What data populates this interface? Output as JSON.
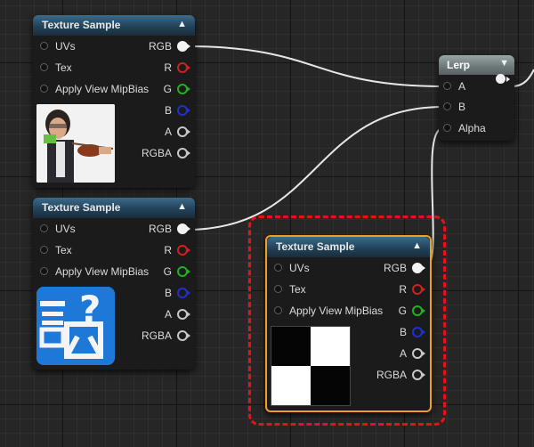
{
  "nodes": [
    {
      "id": "ts1",
      "title": "Texture Sample",
      "inputs": [
        "UVs",
        "Tex",
        "Apply View MipBias"
      ],
      "outputs": [
        "RGB",
        "R",
        "G",
        "B",
        "A",
        "RGBA"
      ],
      "preview": "photo-violinist"
    },
    {
      "id": "ts2",
      "title": "Texture Sample",
      "inputs": [
        "UVs",
        "Tex",
        "Apply View MipBias"
      ],
      "outputs": [
        "RGB",
        "R",
        "G",
        "B",
        "A",
        "RGBA"
      ],
      "preview": "question-mark-kanji-icon",
      "preview_glyph": "?"
    },
    {
      "id": "ts3",
      "title": "Texture Sample",
      "inputs": [
        "UVs",
        "Tex",
        "Apply View MipBias"
      ],
      "outputs": [
        "RGB",
        "R",
        "G",
        "B",
        "A",
        "RGBA"
      ],
      "preview": "black-white-checker",
      "selected": true
    }
  ],
  "lerp": {
    "title": "Lerp",
    "inputs": [
      "A",
      "B",
      "Alpha"
    ]
  },
  "colors": {
    "graph_bg": "#262626",
    "node_body": "#1b1b1b",
    "texture_header": "#2c5672",
    "lerp_header": "#7d8a8a",
    "selection_outline": "#f0a020",
    "annotation_dashed_box": "#e8101a",
    "pin_rgb": "#f2f2f2",
    "pin_r": "#d02020",
    "pin_g": "#20b020",
    "pin_b": "#2030d0",
    "pin_a": "#c8c8c8",
    "wire": "#e6e6e6"
  }
}
